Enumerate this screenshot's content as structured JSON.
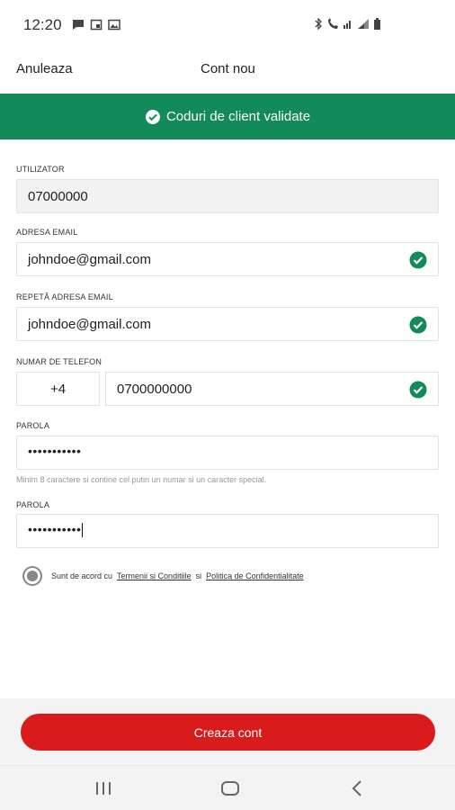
{
  "status_bar": {
    "time": "12:20"
  },
  "header": {
    "cancel_label": "Anuleaza",
    "title": "Cont nou"
  },
  "banner": {
    "text": "Coduri de client validate",
    "color": "#138a5a"
  },
  "form": {
    "user": {
      "label": "UTILIZATOR",
      "value": "07000000"
    },
    "email": {
      "label": "ADRESA EMAIL",
      "value": "johndoe@gmail.com"
    },
    "email_repeat": {
      "label": "REPETĂ ADRESA EMAIL",
      "value": "johndoe@gmail.com"
    },
    "phone": {
      "label": "NUMAR DE TELEFON",
      "prefix": "+4",
      "value": "0700000000"
    },
    "password": {
      "label": "PAROLA",
      "value": "•••••••••••",
      "hint": "Minim 8 caractere si contine cel putin un numar si un caracter special."
    },
    "password_repeat": {
      "label": "PAROLA",
      "value": "•••••••••••"
    }
  },
  "terms": {
    "prefix": "Sunt de acord cu",
    "terms_link": "Termenii si Conditiile",
    "and": "si",
    "privacy_link": "Politica de Confidentialitate"
  },
  "actions": {
    "create_label": "Creaza cont",
    "button_color": "#da1b1b"
  },
  "nav": {
    "recents_icon": "recents-icon",
    "home_icon": "home-icon",
    "back_icon": "back-icon"
  }
}
